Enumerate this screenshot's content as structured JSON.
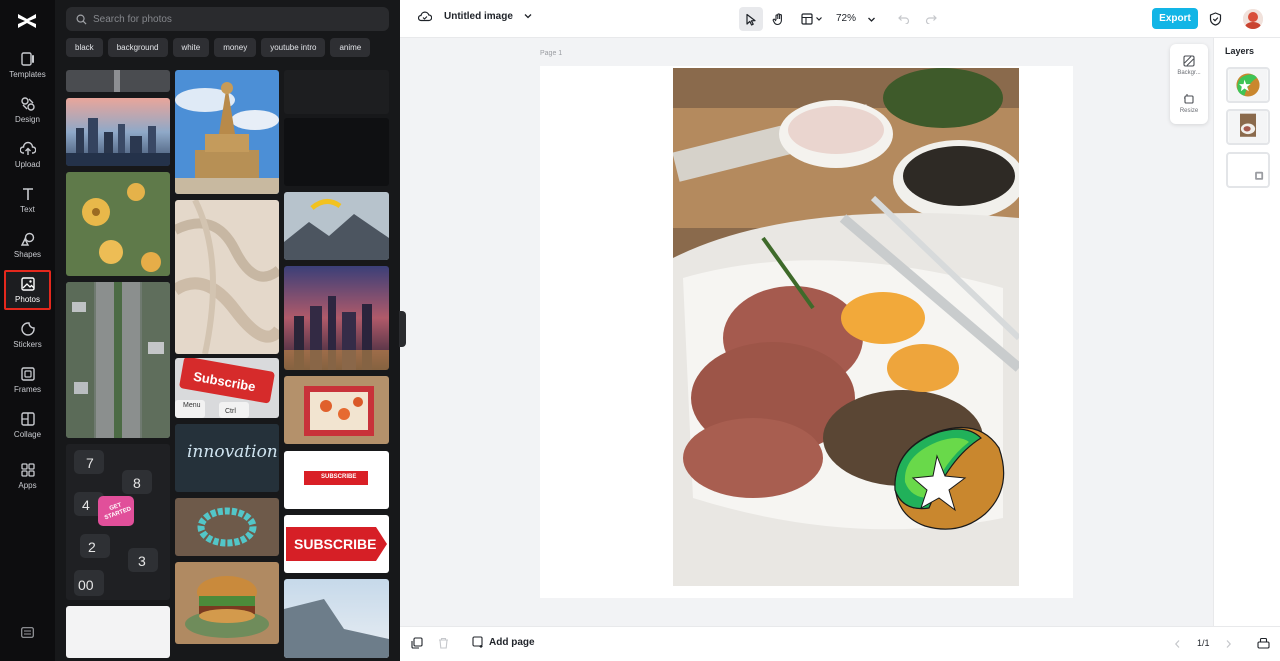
{
  "left_nav": {
    "items": [
      {
        "label": "Templates",
        "icon": "templates-icon"
      },
      {
        "label": "Design",
        "icon": "design-icon"
      },
      {
        "label": "Upload",
        "icon": "upload-icon"
      },
      {
        "label": "Text",
        "icon": "text-icon"
      },
      {
        "label": "Shapes",
        "icon": "shapes-icon"
      },
      {
        "label": "Photos",
        "icon": "photos-icon",
        "active": true
      },
      {
        "label": "Stickers",
        "icon": "stickers-icon"
      },
      {
        "label": "Frames",
        "icon": "frames-icon"
      },
      {
        "label": "Collage",
        "icon": "collage-icon"
      },
      {
        "label": "Apps",
        "icon": "apps-icon"
      }
    ],
    "active_color": "#e5281d"
  },
  "photos_panel": {
    "search_placeholder": "Search for photos",
    "tags": [
      "black",
      "background",
      "white",
      "money",
      "youtube intro",
      "anime"
    ],
    "tile_texts": {
      "subscribe_keyboard": "Subscribe",
      "menu_key": "Menu",
      "ctrl_key": "Ctrl",
      "innovation": "innovation",
      "get_started": "GET STARTED",
      "subscribe_small": "SUBSCRIBE",
      "subscribe_big": "SUBSCRIBE"
    }
  },
  "topbar": {
    "doc_title": "Untitled image",
    "zoom": "72%",
    "export_label": "Export",
    "accent": "#12b5e6"
  },
  "canvas": {
    "page_label": "Page 1"
  },
  "mini_toolbar": {
    "background_label": "Backgr...",
    "resize_label": "Resize"
  },
  "layers": {
    "title": "Layers"
  },
  "bottombar": {
    "add_page_label": "Add page",
    "page_count": "1/1"
  }
}
